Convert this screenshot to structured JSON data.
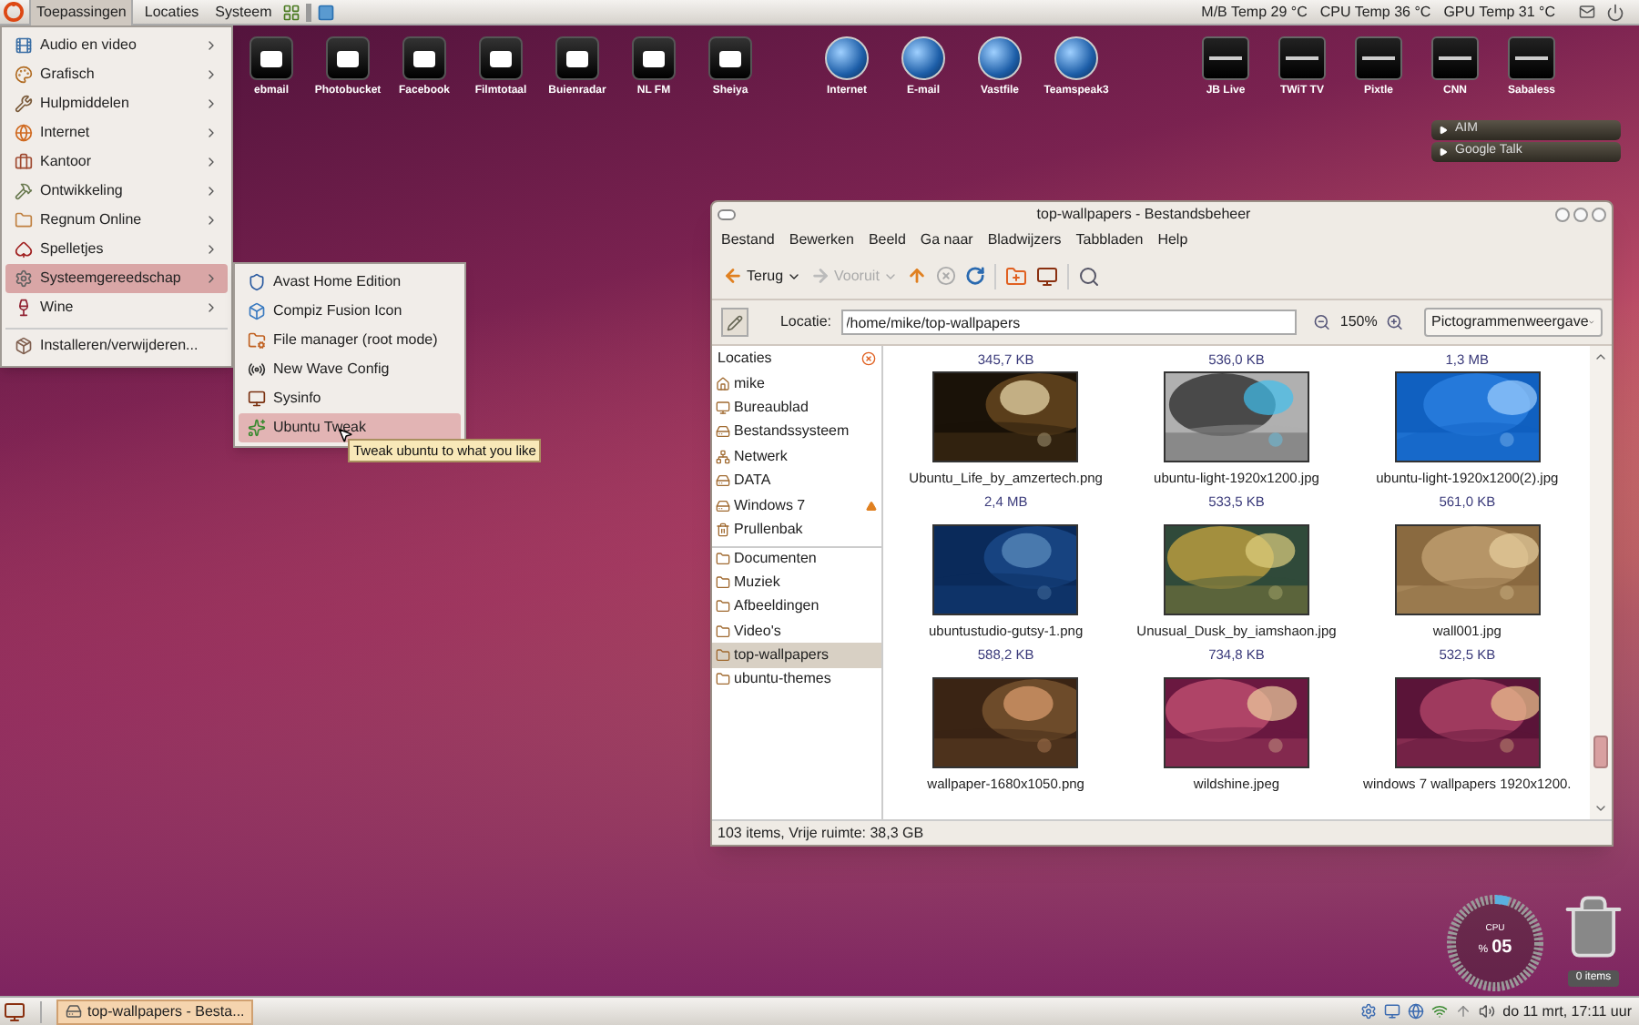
{
  "top_panel": {
    "menus": [
      {
        "label": "Toepassingen",
        "selected": true
      },
      {
        "label": "Locaties",
        "selected": false
      },
      {
        "label": "Systeem",
        "selected": false
      }
    ],
    "sensors": [
      "M/B Temp 29 °C",
      "CPU Temp 36 °C",
      "GPU Temp 31 °C"
    ]
  },
  "desktop_icon_groups": [
    {
      "kind": "tile",
      "icons": [
        "ebmail",
        "Photobucket",
        "Facebook",
        "Filmtotaal",
        "Buienradar",
        "NL FM",
        "Sheiya"
      ]
    },
    {
      "kind": "round",
      "icons": [
        "Internet",
        "E-mail",
        "Vastfile",
        "Teamspeak3"
      ]
    },
    {
      "kind": "tv",
      "icons": [
        "JB Live",
        "TWiT TV",
        "Pixtle",
        "CNN",
        "Sabaless"
      ]
    }
  ],
  "applications_menu": {
    "items": [
      {
        "label": "Audio en video",
        "submenu": true,
        "selected": false,
        "separator_before": false
      },
      {
        "label": "Grafisch",
        "submenu": true,
        "selected": false,
        "separator_before": false
      },
      {
        "label": "Hulpmiddelen",
        "submenu": true,
        "selected": false,
        "separator_before": false
      },
      {
        "label": "Internet",
        "submenu": true,
        "selected": false,
        "separator_before": false
      },
      {
        "label": "Kantoor",
        "submenu": true,
        "selected": false,
        "separator_before": false
      },
      {
        "label": "Ontwikkeling",
        "submenu": true,
        "selected": false,
        "separator_before": false
      },
      {
        "label": "Regnum Online",
        "submenu": true,
        "selected": false,
        "separator_before": false
      },
      {
        "label": "Spelletjes",
        "submenu": true,
        "selected": false,
        "separator_before": false
      },
      {
        "label": "Systeemgereedschap",
        "submenu": true,
        "selected": true,
        "separator_before": false
      },
      {
        "label": "Wine",
        "submenu": true,
        "selected": false,
        "separator_before": false
      },
      {
        "label": "Installeren/verwijderen...",
        "submenu": false,
        "selected": false,
        "separator_before": true
      }
    ]
  },
  "submenu": {
    "items": [
      {
        "label": "Avast Home Edition",
        "selected": false
      },
      {
        "label": "Compiz Fusion Icon",
        "selected": false
      },
      {
        "label": "File manager (root mode)",
        "selected": false
      },
      {
        "label": "New Wave Config",
        "selected": false
      },
      {
        "label": "Sysinfo",
        "selected": false
      },
      {
        "label": "Ubuntu Tweak",
        "selected": true
      }
    ]
  },
  "tooltip": "Tweak ubuntu to what you like",
  "chat_widget": {
    "items": [
      "AIM",
      "Google Talk"
    ]
  },
  "cpu_meter": {
    "label": "CPU",
    "unit": "%",
    "reading": "05",
    "level": 0.05
  },
  "trash": {
    "label": "0 items"
  },
  "file_manager": {
    "title": "top-wallpapers - Bestandsbeheer",
    "menus": [
      "Bestand",
      "Bewerken",
      "Beeld",
      "Ga naar",
      "Bladwijzers",
      "Tabbladen",
      "Help"
    ],
    "toolbar": [
      {
        "label": "Terug",
        "disabled": false
      },
      {
        "label": "Vooruit",
        "disabled": true
      }
    ],
    "location_label": "Locatie:",
    "location": "/home/mike/top-wallpapers",
    "zoom": "150%",
    "view": "Pictogrammenweergave",
    "sidebar": {
      "title": "Locaties",
      "items": [
        {
          "label": "mike",
          "selected": false,
          "separator_before": false,
          "eject": false
        },
        {
          "label": "Bureaublad",
          "selected": false,
          "separator_before": false,
          "eject": false
        },
        {
          "label": "Bestandssysteem",
          "selected": false,
          "separator_before": false,
          "eject": false
        },
        {
          "label": "Netwerk",
          "selected": false,
          "separator_before": false,
          "eject": false
        },
        {
          "label": "DATA",
          "selected": false,
          "separator_before": false,
          "eject": false
        },
        {
          "label": "Windows 7",
          "selected": false,
          "separator_before": false,
          "eject": true
        },
        {
          "label": "Prullenbak",
          "selected": false,
          "separator_before": false,
          "eject": false
        },
        {
          "label": "Documenten",
          "selected": false,
          "separator_before": true,
          "eject": false
        },
        {
          "label": "Muziek",
          "selected": false,
          "separator_before": false,
          "eject": false
        },
        {
          "label": "Afbeeldingen",
          "selected": false,
          "separator_before": false,
          "eject": false
        },
        {
          "label": "Video's",
          "selected": false,
          "separator_before": false,
          "eject": false
        },
        {
          "label": "top-wallpapers",
          "selected": true,
          "separator_before": false,
          "eject": false
        },
        {
          "label": "ubuntu-themes",
          "selected": false,
          "separator_before": false,
          "eject": false
        }
      ]
    },
    "files": [
      {
        "size": "345,7 KB"
      },
      {
        "size": "536,0 KB"
      },
      {
        "size": "1,3 MB"
      },
      {
        "name": "Ubuntu_Life_by_amzertech.png",
        "size": "2,4 MB"
      },
      {
        "name": "ubuntu-light-1920x1200.jpg",
        "size": "533,5 KB"
      },
      {
        "name": "ubuntu-light-1920x1200(2).jpg",
        "size": "561,0 KB"
      },
      {
        "name": "ubuntustudio-gutsy-1.png",
        "size": "588,2 KB"
      },
      {
        "name": "Unusual_Dusk_by_iamshaon.jpg",
        "size": "734,8 KB"
      },
      {
        "name": "wall001.jpg",
        "size": "532,5 KB"
      },
      {
        "name": "wallpaper-1680x1050.png"
      },
      {
        "name": "wildshine.jpeg"
      },
      {
        "name": "windows 7 wallpapers 1920x1200."
      }
    ],
    "status": "103 items, Vrije ruimte: 38,3 GB"
  },
  "taskbar": {
    "tasks": [
      {
        "label": "top-wallpapers - Besta...",
        "selected": true
      }
    ],
    "clock": "do 11 mrt, 17:11 uur"
  }
}
